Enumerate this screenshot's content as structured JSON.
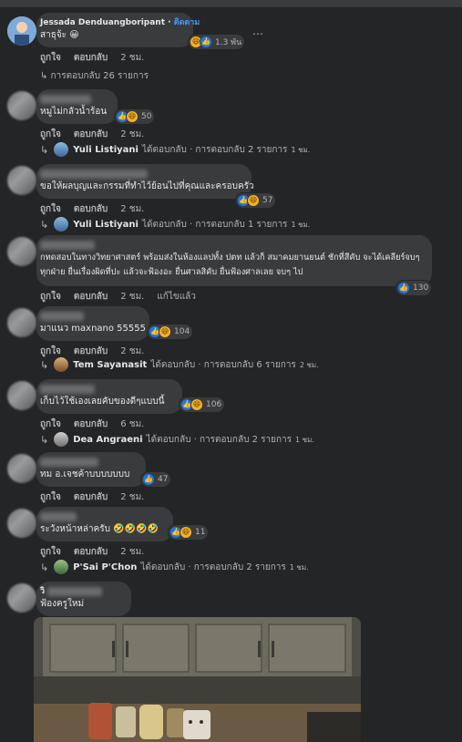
{
  "comments": [
    {
      "author": "Jessada Denduangboripant",
      "follow": "ติดตาม",
      "text": "สาธุจ้ะ 😀",
      "reactions": "1.3 พัน",
      "actions": {
        "like": "ถูกใจ",
        "reply": "ตอบกลับ",
        "time": "2 ชม."
      },
      "replies": "↳ การตอบกลับ 26 รายการ"
    },
    {
      "text": "หมูไม่กลัวน้ำร้อน",
      "reactions": "50",
      "actions": {
        "like": "ถูกใจ",
        "reply": "ตอบกลับ",
        "time": "2 ชม."
      },
      "reply": {
        "name": "Yuli Listiyani",
        "rest": "ได้ตอบกลับ · การตอบกลับ 2 รายการ",
        "time": "1 ชม."
      }
    },
    {
      "text": "ขอให้ผลบุญและกรรมที่ทำไว้ย้อนไปที่คุณและครอบครัว",
      "reactions": "57",
      "actions": {
        "like": "ถูกใจ",
        "reply": "ตอบกลับ",
        "time": "2 ชม."
      },
      "reply": {
        "name": "Yuli Listiyani",
        "rest": "ได้ตอบกลับ · การตอบกลับ 1 รายการ",
        "time": "1 ชม."
      }
    },
    {
      "text": "กทดสอบในทางวิทยาศาสตร์ พร้อมส่งในห้องแลปทั้ง ปตท แล้วก็ สมาคมยานยนต์ ชักที่สีคับ จะได้เคลียร์จบๆ ทุกฝ่าย ยื่นเรื่องผิดที่ปะ แล้วจะฟ้องอะ ยื่นศาลสิคับ ยื่นฟ้องศาลเลย จบๆ ไป",
      "reactions": "130",
      "actions": {
        "like": "ถูกใจ",
        "reply": "ตอบกลับ",
        "time": "2 ชม.",
        "edited": "แก้ไขแล้ว"
      }
    },
    {
      "text": "มาแนว maxnano 55555",
      "reactions": "104",
      "actions": {
        "like": "ถูกใจ",
        "reply": "ตอบกลับ",
        "time": "2 ชม."
      },
      "reply": {
        "name": "Tem Sayanasit",
        "rest": "ได้ตอบกลับ · การตอบกลับ 6 รายการ",
        "time": "2 ชม."
      }
    },
    {
      "text": "เก็บไว้ใช้เองเลยคับของดีๆแบบนี้",
      "reactions": "106",
      "actions": {
        "like": "ถูกใจ",
        "reply": "ตอบกลับ",
        "time": "6 ชม."
      },
      "reply": {
        "name": "Dea Angraeni",
        "rest": "ได้ตอบกลับ · การตอบกลับ 2 รายการ",
        "time": "1 ชม."
      }
    },
    {
      "text": "ทม อ.เจชค้าบบบบบบบ",
      "reactions": "47",
      "actions": {
        "like": "ถูกใจ",
        "reply": "ตอบกลับ",
        "time": "2 ชม."
      }
    },
    {
      "text": "ระวังหน้าหล่าครับ 🤣🤣🤣🤣",
      "reactions": "11",
      "actions": {
        "like": "ถูกใจ",
        "reply": "ตอบกลับ",
        "time": "2 ชม."
      },
      "reply": {
        "name": "P'Sai P'Chon",
        "rest": "ได้ตอบกลับ · การตอบกลับ 2 รายการ",
        "time": "1 ชม."
      }
    },
    {
      "name_fragment": "วิ",
      "text": "ฟ้องครูใหม่"
    }
  ]
}
